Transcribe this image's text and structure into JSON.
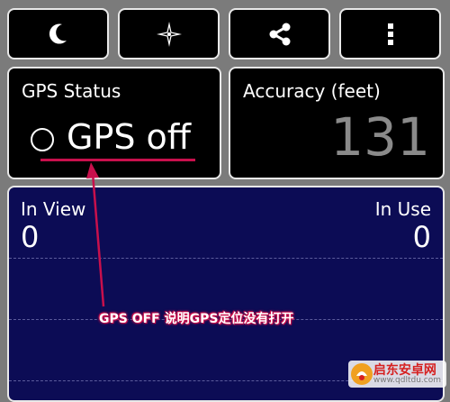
{
  "toolbar": {
    "buttons": [
      {
        "icon": "moon-icon",
        "name": "night-mode-button"
      },
      {
        "icon": "compass-icon",
        "name": "compass-button"
      },
      {
        "icon": "share-icon",
        "name": "share-button"
      },
      {
        "icon": "overflow-menu-icon",
        "name": "more-options-button"
      }
    ]
  },
  "gps_status": {
    "label": "GPS Status",
    "value": "GPS off"
  },
  "accuracy": {
    "label": "Accuracy (feet)",
    "value": "131"
  },
  "satellites": {
    "in_view_label": "In View",
    "in_view_value": "0",
    "in_use_label": "In Use",
    "in_use_value": "0"
  },
  "annotation": {
    "text": "GPS OFF 说明GPS定位没有打开",
    "color": "#c8104c"
  },
  "watermark": {
    "title": "启东安卓网",
    "url": "www.qdltdu.com"
  },
  "colors": {
    "background": "#7b7b7b",
    "card": "#000000",
    "panel": "#0c0c55",
    "accent": "#c8104c",
    "muted_value": "#8a8a8a"
  }
}
